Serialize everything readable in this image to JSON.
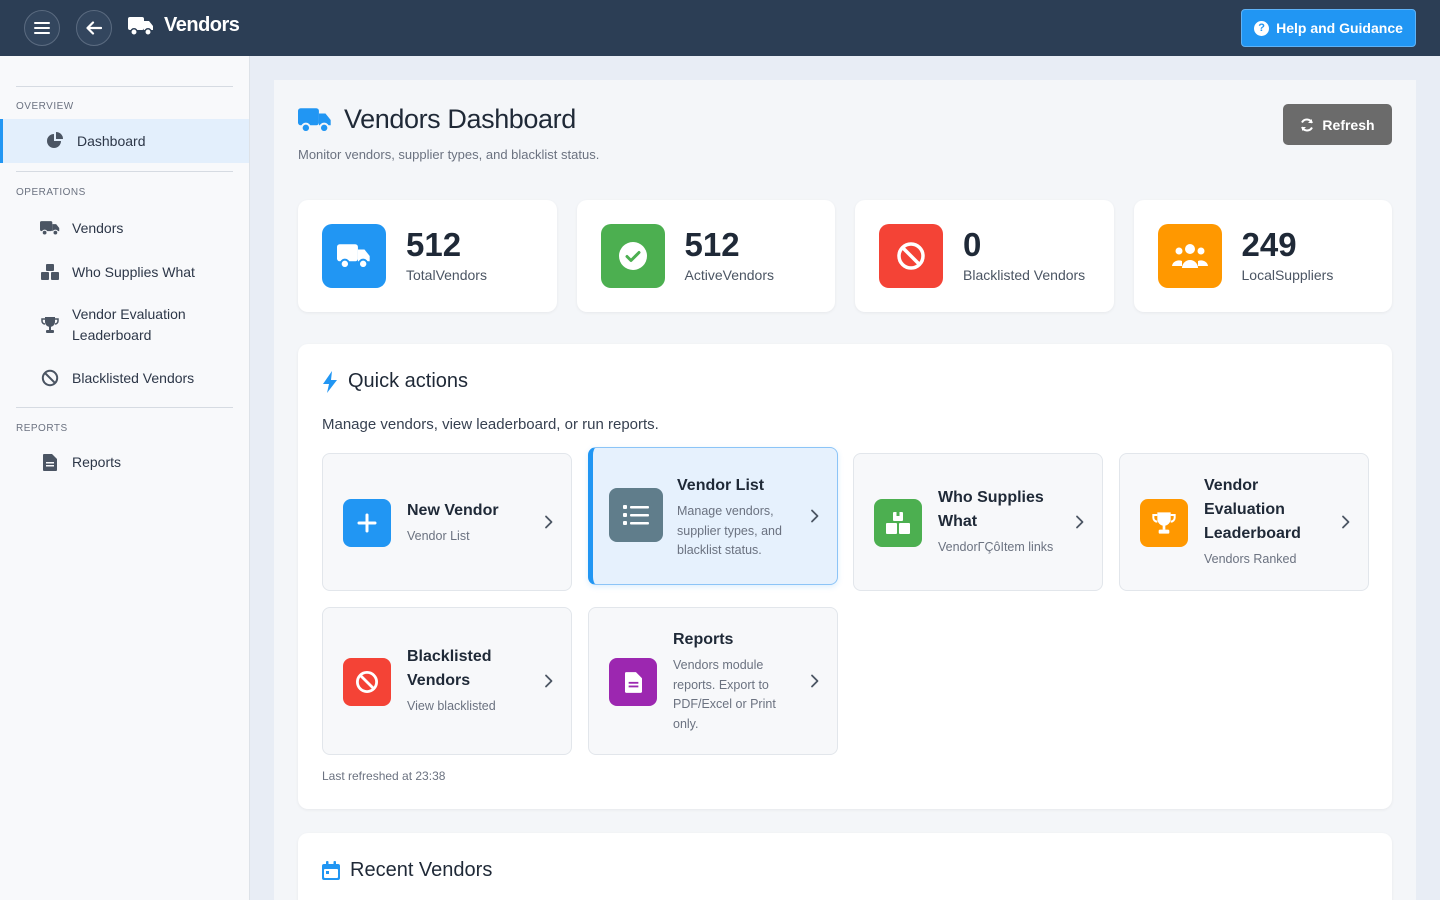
{
  "topbar": {
    "title": "Vendors",
    "help_label": "Help and Guidance"
  },
  "sidebar": {
    "sections": [
      {
        "label": "OVERVIEW",
        "items": [
          {
            "label": "Dashboard",
            "icon": "pie-chart-icon",
            "active": true
          }
        ]
      },
      {
        "label": "OPERATIONS",
        "items": [
          {
            "label": "Vendors",
            "icon": "truck-icon"
          },
          {
            "label": "Who Supplies What",
            "icon": "boxes-icon"
          },
          {
            "label": "Vendor Evaluation Leaderboard",
            "icon": "trophy-icon"
          },
          {
            "label": "Blacklisted Vendors",
            "icon": "ban-icon"
          }
        ]
      },
      {
        "label": "REPORTS",
        "items": [
          {
            "label": "Reports",
            "icon": "file-icon"
          }
        ]
      }
    ]
  },
  "page": {
    "title": "Vendors Dashboard",
    "subtitle": "Monitor vendors, supplier types, and blacklist status.",
    "refresh_label": "Refresh"
  },
  "stats": [
    {
      "value": "512",
      "label": "TotalVendors",
      "color": "#2196f3",
      "icon": "truck-icon"
    },
    {
      "value": "512",
      "label": "ActiveVendors",
      "color": "#4caf50",
      "icon": "check-circle-icon"
    },
    {
      "value": "0",
      "label": "Blacklisted Vendors",
      "color": "#f44336",
      "icon": "ban-icon"
    },
    {
      "value": "249",
      "label": "LocalSuppliers",
      "color": "#ff9800",
      "icon": "users-icon"
    }
  ],
  "quick_actions": {
    "title": "Quick actions",
    "subtitle": "Manage vendors, view leaderboard, or run reports.",
    "tiles": [
      {
        "title": "New Vendor",
        "desc": "Vendor List",
        "color": "#2196f3",
        "icon": "plus-icon"
      },
      {
        "title": "Vendor List",
        "desc": "Manage vendors, supplier types, and blacklist status.",
        "color": "#607d8b",
        "icon": "list-icon"
      },
      {
        "title": "Who Supplies What",
        "desc": "VendorΓÇôItem links",
        "color": "#4caf50",
        "icon": "boxes-icon"
      },
      {
        "title": "Vendor Evaluation Leaderboard",
        "desc": "Vendors Ranked",
        "color": "#ff9800",
        "icon": "trophy-icon"
      },
      {
        "title": "Blacklisted Vendors",
        "desc": "View blacklisted",
        "color": "#f44336",
        "icon": "ban-icon"
      },
      {
        "title": "Reports",
        "desc": "Vendors module reports. Export to PDF/Excel or Print only.",
        "color": "#9c27b0",
        "icon": "file-icon"
      }
    ],
    "last_refreshed": "Last refreshed at 23:38"
  },
  "recent": {
    "title": "Recent Vendors"
  }
}
